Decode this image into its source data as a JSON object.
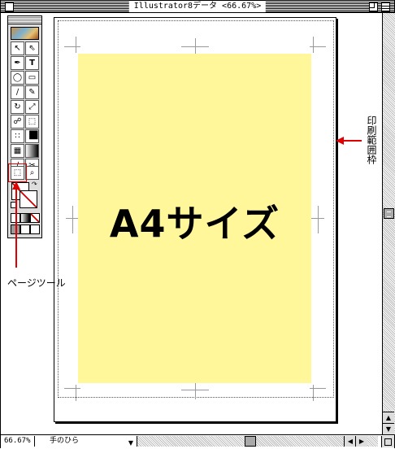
{
  "window": {
    "title": "Illustrator8データ <66.67%>"
  },
  "artwork": {
    "label": "A4サイズ",
    "page_color": "#fff79a"
  },
  "annotations": {
    "print_area_label": "印刷範囲枠",
    "page_tool_label": "ページツール",
    "arrow_color": "#e00000"
  },
  "status_bar": {
    "zoom": "66.67%",
    "status_popup": "手のひら"
  },
  "toolbox": {
    "icons": [
      "selection-tool-icon",
      "direct-selection-tool-icon",
      "pen-tool-icon",
      "type-tool-icon",
      "ellipse-tool-icon",
      "rectangle-tool-icon",
      "paintbrush-tool-icon",
      "pencil-tool-icon",
      "rotate-tool-icon",
      "scale-tool-icon",
      "twirl-tool-icon",
      "free-transform-tool-icon",
      "blend-tool-icon",
      "graph-tool-icon",
      "gradient-mesh-tool-icon",
      "gradient-tool-icon",
      "eyedropper-tool-icon",
      "scissors-tool-icon",
      "page-tool-icon",
      "zoom-tool-icon"
    ]
  }
}
